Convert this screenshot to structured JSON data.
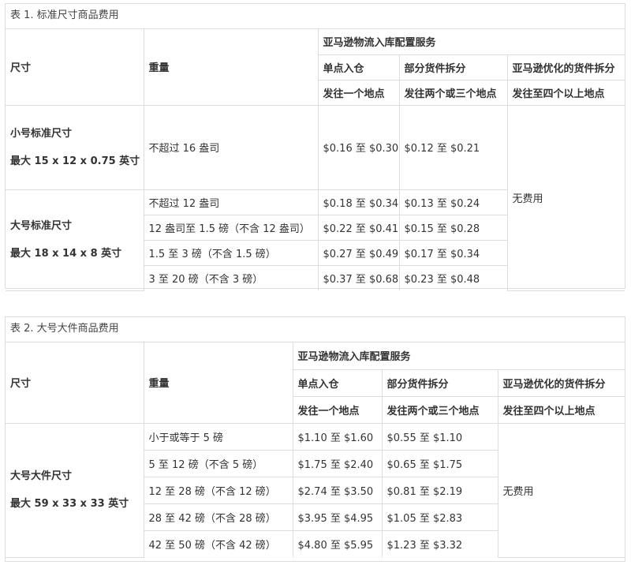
{
  "table1": {
    "caption": "表 1. 标准尺寸商品费用",
    "headers": {
      "size": "尺寸",
      "weight": "重量",
      "service": "亚马逊物流入库配置服务",
      "single": "单点入仓",
      "partial": "部分货件拆分",
      "optimized": "亚马逊优化的货件拆分",
      "single_sub": "发往一个地点",
      "partial_sub": "发往两个或三个地点",
      "optimized_sub": "发往至四个以上地点"
    },
    "groups": [
      {
        "size_name": "小号标准尺寸",
        "size_limit": "最大 15 x 12 x 0.75 英寸",
        "rows": [
          {
            "weight": "不超过 16 盎司",
            "single": "$0.16 至 $0.30",
            "partial": "$0.12 至 $0.21"
          }
        ]
      },
      {
        "size_name": "大号标准尺寸",
        "size_limit": "最大 18 x 14 x 8 英寸",
        "rows": [
          {
            "weight": "不超过 12 盎司",
            "single": "$0.18 至 $0.34",
            "partial": "$0.13 至 $0.24"
          },
          {
            "weight": "12 盎司至 1.5 磅（不含 12 盎司）",
            "single": "$0.22 至 $0.41",
            "partial": "$0.15 至 $0.28"
          },
          {
            "weight": "1.5 至 3 磅（不含 1.5 磅）",
            "single": "$0.27 至 $0.49",
            "partial": "$0.17 至 $0.34"
          },
          {
            "weight": "3 至 20 磅（不含 3 磅）",
            "single": "$0.37 至 $0.68",
            "partial": "$0.23 至 $0.48"
          }
        ]
      }
    ],
    "optimized_fee": "无费用"
  },
  "table2": {
    "caption": "表 2. 大号大件商品费用",
    "headers": {
      "size": "尺寸",
      "weight": "重量",
      "service": "亚马逊物流入库配置服务",
      "single": "单点入仓",
      "partial": "部分货件拆分",
      "optimized": "亚马逊优化的货件拆分",
      "single_sub": "发往一个地点",
      "partial_sub": "发往两个或三个地点",
      "optimized_sub": "发往至四个以上地点"
    },
    "size_name": "大号大件尺寸",
    "size_limit": "最大 59 x 33 x 33 英寸",
    "rows": [
      {
        "weight": "小于或等于 5 磅",
        "single": "$1.10 至 $1.60",
        "partial": "$0.55 至 $1.10"
      },
      {
        "weight": "5 至 12 磅（不含 5 磅）",
        "single": "$1.75 至 $2.40",
        "partial": "$0.65 至 $1.75"
      },
      {
        "weight": "12 至 28 磅（不含 12 磅）",
        "single": "$2.74 至 $3.50",
        "partial": "$0.81 至 $2.19"
      },
      {
        "weight": "28 至 42 磅（不含 28 磅）",
        "single": "$3.95 至 $4.95",
        "partial": "$1.05 至 $2.83"
      },
      {
        "weight": "42 至 50 磅（不含 42 磅）",
        "single": "$4.80 至 $5.95",
        "partial": "$1.23 至 $3.32"
      }
    ],
    "optimized_fee": "无费用"
  }
}
